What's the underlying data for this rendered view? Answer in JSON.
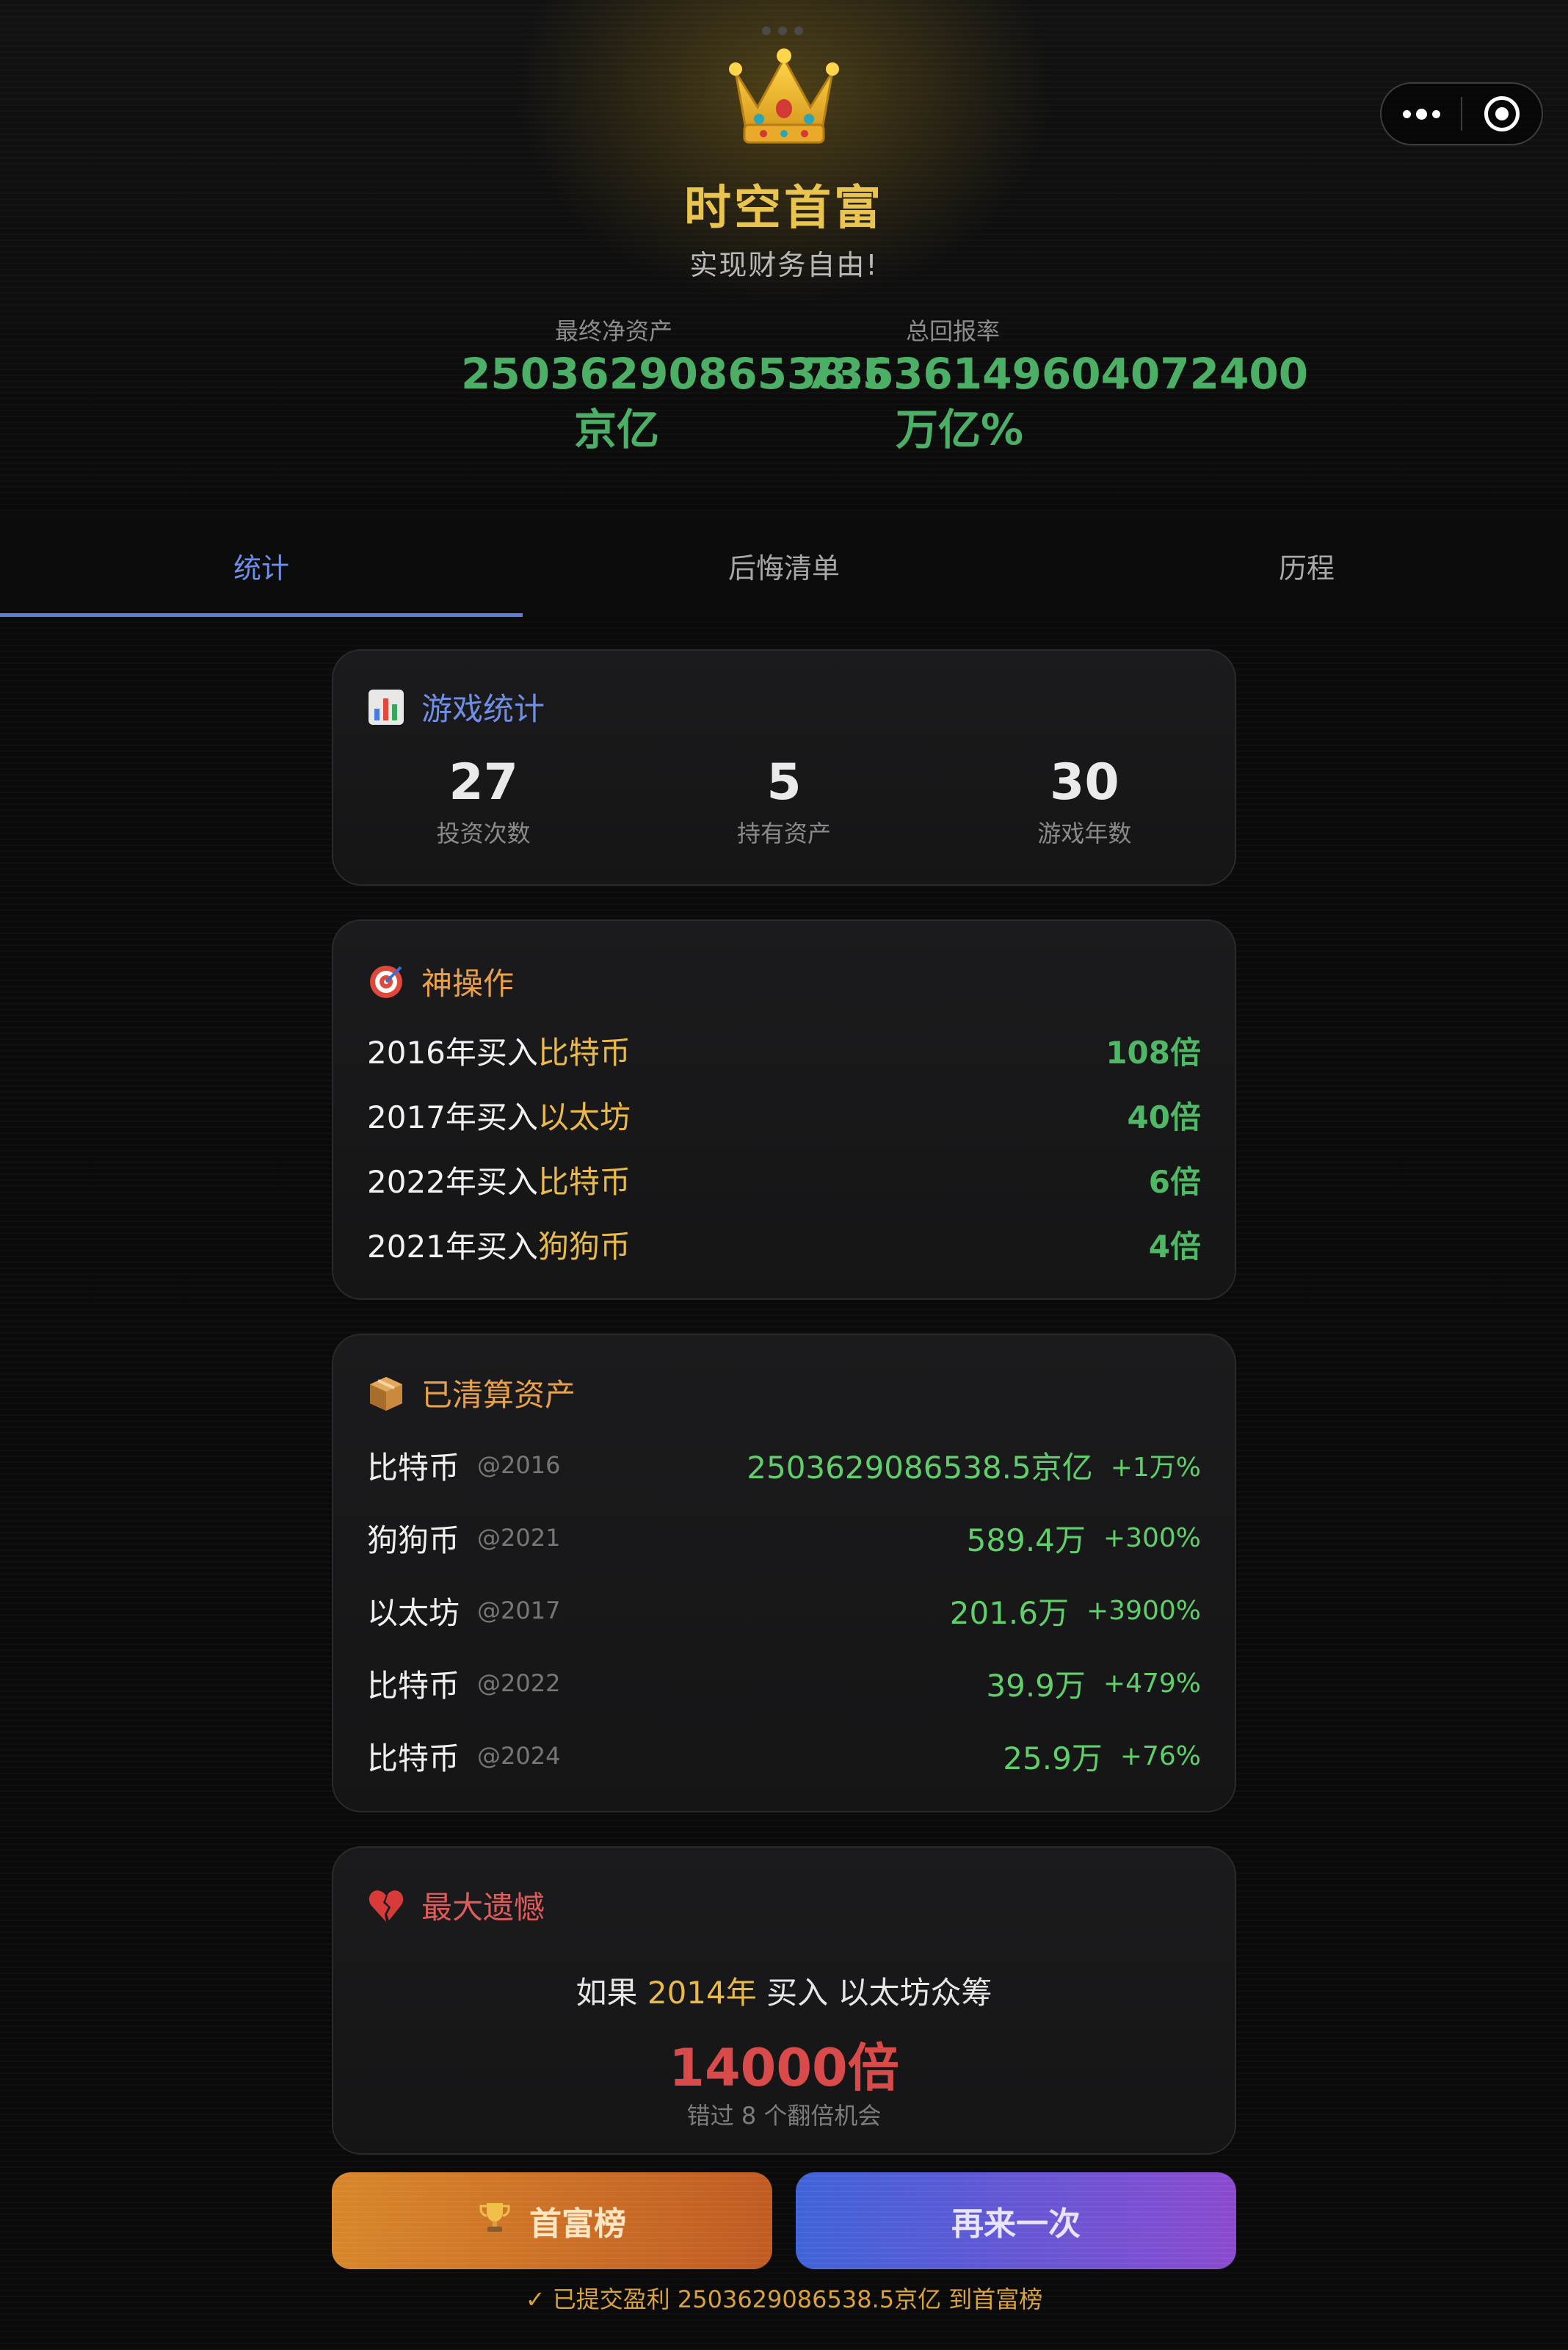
{
  "header": {
    "title": "时空首富",
    "subtitle": "实现财务自由!",
    "net_assets_label": "最终净资产",
    "net_assets_value": "2503629086538.5",
    "net_assets_unit": "京亿",
    "return_label": "总回报率",
    "return_value": "73636149604072400",
    "return_unit": "万亿%"
  },
  "tabs": [
    {
      "label": "统计",
      "active": true
    },
    {
      "label": "后悔清单",
      "active": false
    },
    {
      "label": "历程",
      "active": false
    }
  ],
  "game_stats": {
    "icon": "bar-chart-icon",
    "title": "游戏统计",
    "items": [
      {
        "value": "27",
        "label": "投资次数"
      },
      {
        "value": "5",
        "label": "持有资产"
      },
      {
        "value": "30",
        "label": "游戏年数"
      }
    ]
  },
  "god_moves": {
    "icon": "target-icon",
    "title": "神操作",
    "items": [
      {
        "prefix": "2016年买入",
        "asset": "比特币",
        "multiple": "108倍"
      },
      {
        "prefix": "2017年买入",
        "asset": "以太坊",
        "multiple": "40倍"
      },
      {
        "prefix": "2022年买入",
        "asset": "比特币",
        "multiple": "6倍"
      },
      {
        "prefix": "2021年买入",
        "asset": "狗狗币",
        "multiple": "4倍"
      }
    ]
  },
  "liquidated": {
    "icon": "package-icon",
    "title": "已清算资产",
    "items": [
      {
        "name": "比特币",
        "year": "@2016",
        "value": "2503629086538.5京亿",
        "pct": "+1万%"
      },
      {
        "name": "狗狗币",
        "year": "@2021",
        "value": "589.4万",
        "pct": "+300%"
      },
      {
        "name": "以太坊",
        "year": "@2017",
        "value": "201.6万",
        "pct": "+3900%"
      },
      {
        "name": "比特币",
        "year": "@2022",
        "value": "39.9万",
        "pct": "+479%"
      },
      {
        "name": "比特币",
        "year": "@2024",
        "value": "25.9万",
        "pct": "+76%"
      }
    ]
  },
  "regret": {
    "icon": "broken-heart-icon",
    "title": "最大遗憾",
    "if_text": "如果",
    "year": "2014年",
    "buy_text": "买入",
    "asset": "以太坊众筹",
    "multiple": "14000倍",
    "missed": "错过 8 个翻倍机会"
  },
  "buttons": {
    "rank_icon": "trophy-icon",
    "rank_label": "首富榜",
    "again_label": "再来一次"
  },
  "footer": "✓ 已提交盈利 2503629086538.5京亿 到首富榜",
  "colors": {
    "gold": "#e9c44e",
    "green": "#4caf66",
    "accent_blue": "#5b7ee0",
    "red": "#d94a4a"
  }
}
